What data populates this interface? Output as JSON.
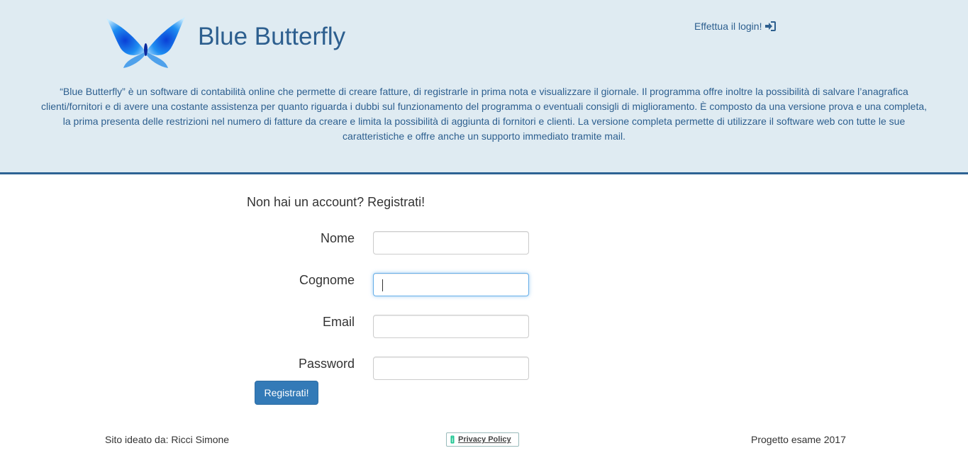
{
  "header": {
    "title": "Blue Butterfly",
    "logo_icon": "butterfly-logo-icon",
    "login_link_label": "Effettua il login!",
    "login_icon": "sign-in-icon",
    "description": "“Blue Butterfly” è un software di contabilità online che permette di creare fatture, di registrarle in prima nota e visualizzare il giornale. Il programma offre inoltre la possibilità di salvare l’anagrafica clienti/fornitori e di avere una costante assistenza per quanto riguarda i dubbi sul funzionamento del programma o eventuali consigli di miglioramento. È composto da una versione prova e una completa, la prima presenta delle restrizioni nel numero di fatture da creare e limita la possibilità di aggiunta di fornitori e clienti. La versione completa permette di utilizzare il software web con tutte le sue caratteristiche e offre anche un supporto immediato tramite mail.",
    "accent_color": "#2e6394",
    "background_color": "#dfebf2"
  },
  "form": {
    "heading": "Non hai un account? Registrati!",
    "fields": [
      {
        "label": "Nome",
        "value": ""
      },
      {
        "label": "Cognome",
        "value": ""
      },
      {
        "label": "Email",
        "value": ""
      },
      {
        "label": "Password",
        "value": ""
      }
    ],
    "submit_label": "Registrati!",
    "button_color": "#337ab7"
  },
  "footer": {
    "author": "Sito ideato da: Ricci Simone",
    "privacy_label": "Privacy Policy",
    "privacy_icon": "iubenda-privacy-icon",
    "project": "Progetto esame 2017"
  }
}
